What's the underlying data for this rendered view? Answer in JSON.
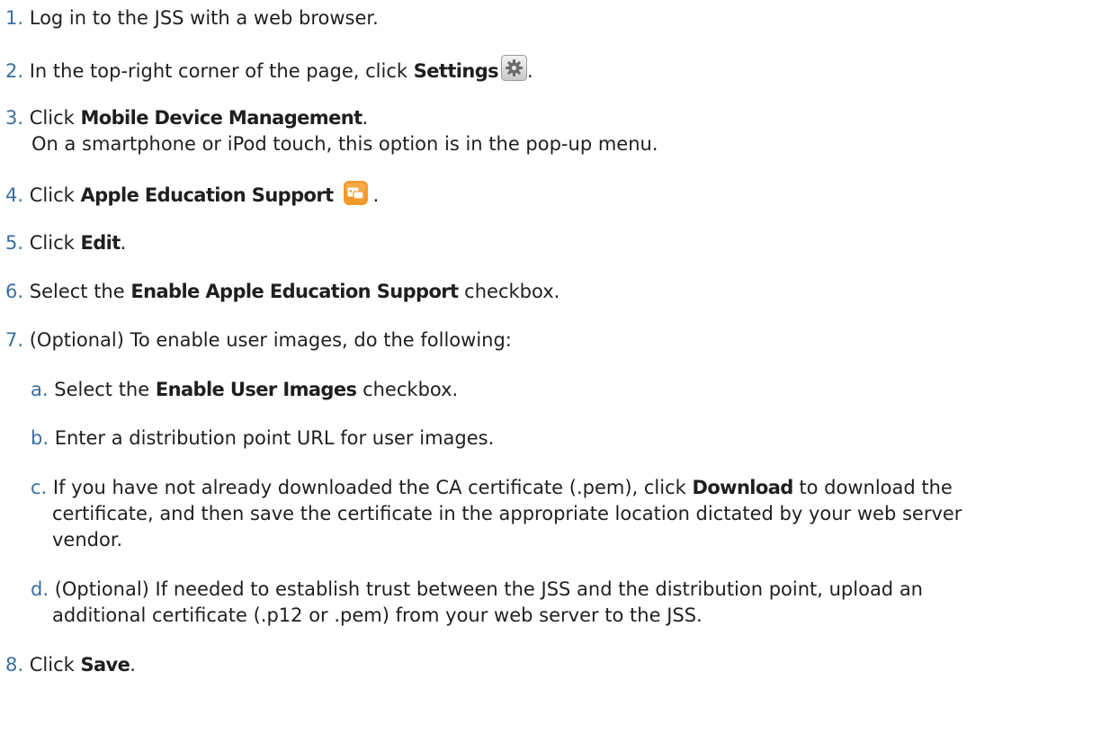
{
  "steps": [
    {
      "num": "1.",
      "text": "Log in to the JSS with a web browser."
    },
    {
      "num": "2.",
      "pre": "In the top-right corner of the page, click ",
      "bold": "Settings",
      "icon": "settings-gear-icon",
      "post": "."
    },
    {
      "num": "3.",
      "pre": "Click ",
      "bold": "Mobile Device Management",
      "post": ".",
      "note": "On a smartphone or iPod touch, this option is in the pop-up menu."
    },
    {
      "num": "4.",
      "pre": "Click ",
      "bold": "Apple Education Support",
      "icon": "apple-education-support-icon",
      "post": "."
    },
    {
      "num": "5.",
      "pre": "Click ",
      "bold": "Edit",
      "post": "."
    },
    {
      "num": "6.",
      "pre": "Select the ",
      "bold": "Enable Apple Education Support",
      "post": " checkbox."
    },
    {
      "num": "7.",
      "text": "(Optional) To enable user images, do the following:",
      "substeps": [
        {
          "letter": "a.",
          "pre": "Select the ",
          "bold": "Enable User Images",
          "post": " checkbox."
        },
        {
          "letter": "b.",
          "text": "Enter a distribution point URL for user images."
        },
        {
          "letter": "c.",
          "pre": "If you have not already downloaded the CA certificate (.pem), click ",
          "bold": "Download",
          "post": " to download the",
          "line2": "certificate, and then save the certificate in the appropriate location dictated by your web server",
          "line3": "vendor."
        },
        {
          "letter": "d.",
          "text": "(Optional) If needed to establish trust between the JSS and the distribution point, upload an",
          "line2": "additional certificate (.p12 or .pem) from your web server to the JSS."
        }
      ]
    },
    {
      "num": "8.",
      "pre": "Click ",
      "bold": "Save",
      "post": "."
    }
  ],
  "colors": {
    "number": "#3b6f9e",
    "text": "#1f1f1f",
    "ase_icon": "#f39a2b"
  }
}
